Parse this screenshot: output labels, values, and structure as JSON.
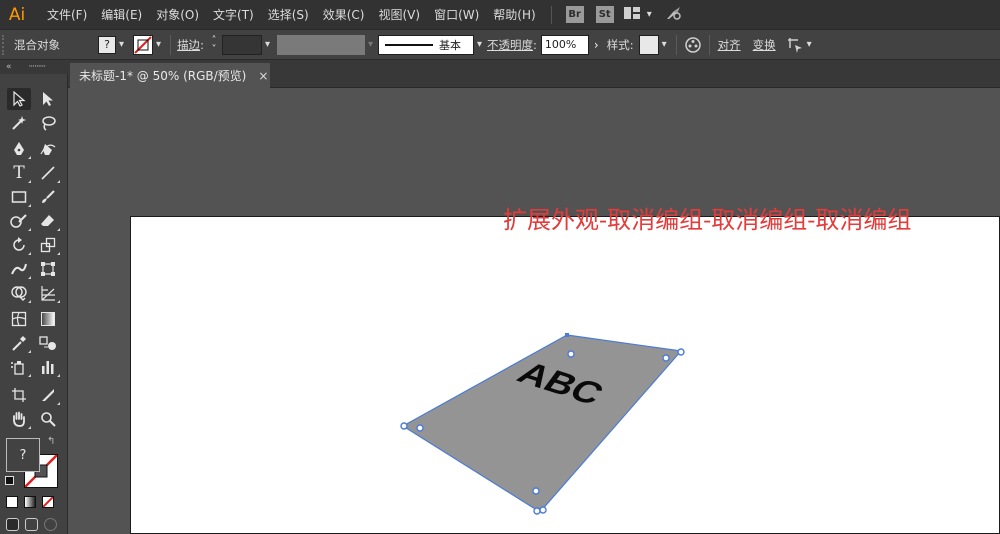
{
  "app": {
    "logo": "Ai"
  },
  "menu": {
    "items": [
      "文件(F)",
      "编辑(E)",
      "对象(O)",
      "文字(T)",
      "选择(S)",
      "效果(C)",
      "视图(V)",
      "窗口(W)",
      "帮助(H)"
    ],
    "bridge_badge": "Br",
    "stock_badge": "St",
    "workspace_icon": "workspace-grid-icon",
    "gpu_icon": "rocket-icon"
  },
  "control": {
    "selection_label": "混合对象",
    "fill_value": "?",
    "stroke_label": "描边",
    "stroke_brush": "基本",
    "opacity_label": "不透明度",
    "opacity_value": "100%",
    "style_label": "样式",
    "align_label": "对齐",
    "transform_label": "变换"
  },
  "document": {
    "tab_title": "未标题-1* @ 50% (RGB/预览)",
    "close_glyph": "×"
  },
  "annotation": {
    "text": "扩展外观-取消编组-取消编组-取消编组",
    "color": "#e43b3b"
  },
  "artwork": {
    "text": "ABC",
    "fill": "#949494",
    "selection_color": "#4a7bd8"
  },
  "toolbar": {
    "fill_swatch_value": "?",
    "tools": [
      "selection-tool",
      "direct-selection-tool",
      "magic-wand-tool",
      "lasso-tool",
      "pen-tool",
      "curvature-tool",
      "type-tool",
      "line-tool",
      "rectangle-tool",
      "paintbrush-tool",
      "shaper-tool",
      "eraser-tool",
      "rotate-tool",
      "scale-tool",
      "warp-tool",
      "free-transform-tool",
      "shape-builder-tool",
      "perspective-grid-tool",
      "mesh-tool",
      "gradient-tool",
      "eyedropper-tool",
      "blend-tool",
      "symbol-sprayer-tool",
      "column-graph-tool",
      "artboard-tool",
      "slice-tool",
      "hand-tool",
      "zoom-tool"
    ]
  }
}
